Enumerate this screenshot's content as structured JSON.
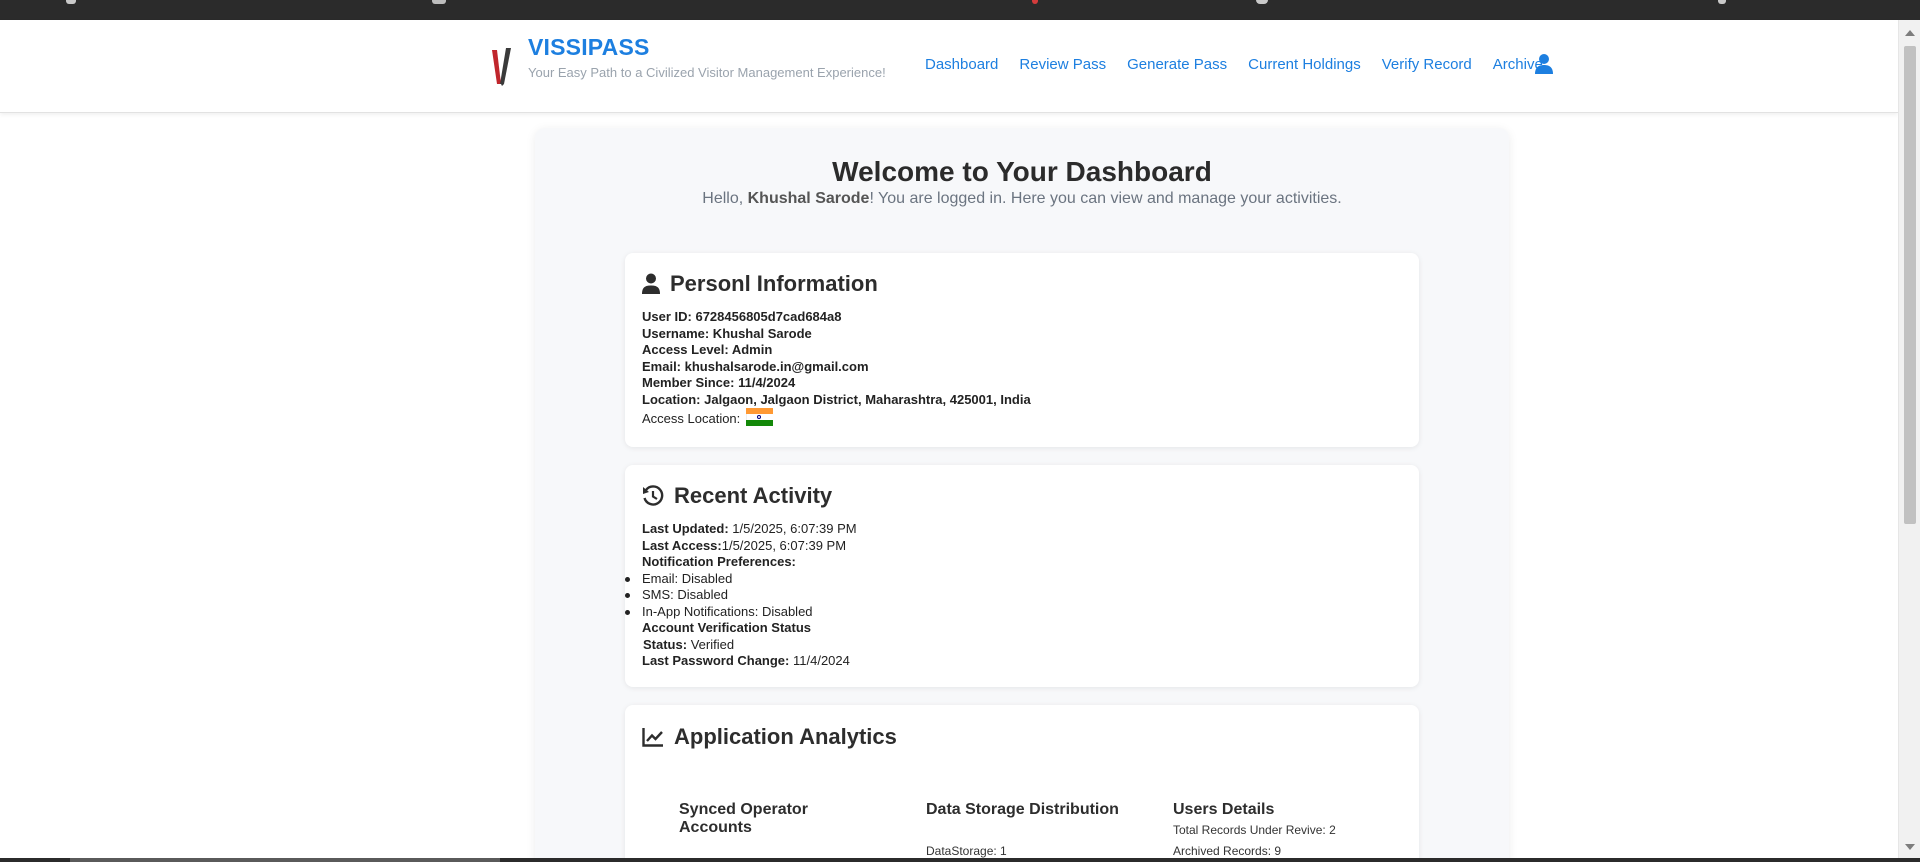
{
  "brand": {
    "title": "VISSIPASS",
    "tagline": "Your Easy Path to a Civilized Visitor Management Experience!"
  },
  "nav": {
    "items": [
      {
        "label": "Dashboard"
      },
      {
        "label": "Review Pass"
      },
      {
        "label": "Generate Pass"
      },
      {
        "label": "Current Holdings"
      },
      {
        "label": "Verify Record"
      },
      {
        "label": "Archive"
      }
    ],
    "profile_icon": "user-icon"
  },
  "dashboard": {
    "title": "Welcome to Your Dashboard",
    "greeting_prefix": "Hello, ",
    "user_name": "Khushal Sarode",
    "greeting_suffix": "! You are logged in. Here you can view and manage your activities."
  },
  "personal": {
    "heading": "Personl Information",
    "icon": "person-icon",
    "lines": [
      "User ID: 6728456805d7cad684a8",
      "Username: Khushal Sarode",
      "Access Level: Admin",
      "Email: khushalsarode.in@gmail.com",
      "Member Since: 11/4/2024",
      "Location: Jalgaon, Jalgaon District, Maharashtra, 425001, India"
    ],
    "access_location_label": "Access Location:",
    "access_location_flag": "india-flag-icon"
  },
  "activity": {
    "heading": "Recent Activity",
    "icon": "history-icon",
    "last_updated_label": "Last Updated:",
    "last_updated_value": "1/5/2025, 6:07:39 PM",
    "last_access_label": "Last Access:",
    "last_access_value": "1/5/2025, 6:07:39 PM",
    "notif_label": "Notification Preferences:",
    "notifications": [
      "Email: Disabled",
      "SMS: Disabled",
      "In-App Notifications: Disabled"
    ],
    "verification_label": "Account Verification Status",
    "status_label": "Status:",
    "status_value": "Verified",
    "password_label": "Last Password Change:",
    "password_value": "11/4/2024"
  },
  "analytics": {
    "heading": "Application Analytics",
    "icon": "line-chart-icon",
    "synced_title": "Synced Operator Accounts",
    "storage_title": "Data Storage Distribution",
    "storage_line": "DataStorage: 1",
    "users_title": "Users Details",
    "users_lines": [
      "Total Records Under Revive: 2",
      "Archived Records: 9"
    ]
  },
  "colors": {
    "accent": "#1d7fe0",
    "page_bg": "#f7f8fa"
  }
}
